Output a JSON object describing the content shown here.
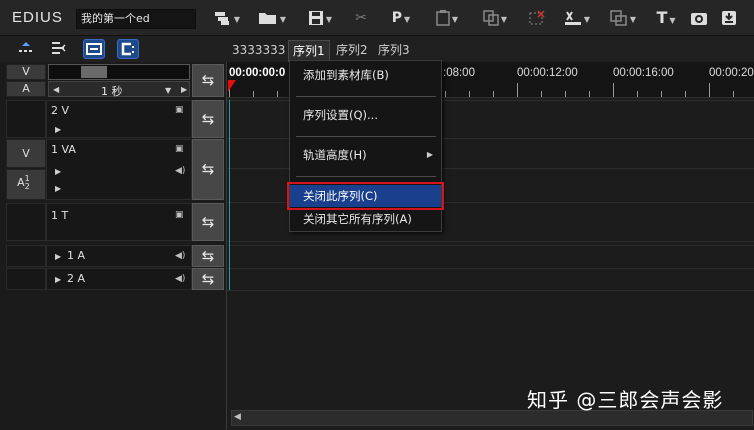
{
  "app": {
    "name": "EDIUS",
    "project_name": "我的第一个ed"
  },
  "toolbar": {
    "items": [
      "new-sequence-icon",
      "open-folder-icon",
      "save-icon",
      "cut-icon",
      "p-icon",
      "clipboard-icon",
      "copy-icon",
      "delete-icon",
      "in-out-icon",
      "ripple-icon",
      "text-icon",
      "capture-icon",
      "export-icon"
    ],
    "p_label": "P",
    "t_label": "T"
  },
  "tabs": [
    {
      "label": "3333333",
      "active": false
    },
    {
      "label": "序列1",
      "active": true
    },
    {
      "label": "序列2",
      "active": false
    },
    {
      "label": "序列3",
      "active": false
    }
  ],
  "header": {
    "v_label": "V",
    "a_label": "A",
    "scale_label": "1 秒"
  },
  "tracks": [
    {
      "name": "2 V"
    },
    {
      "name": "1 VA",
      "v_label": "V",
      "a_label": "A",
      "a_sup": "1",
      "a_sub": "2"
    },
    {
      "name": "1 T"
    },
    {
      "name": "1 A"
    },
    {
      "name": "2 A"
    }
  ],
  "timeline": {
    "timecodes": [
      "00:00:00:0",
      ":08:00",
      "00:00:12:00",
      "00:00:16:00",
      "00:00:20"
    ]
  },
  "menu": {
    "items": [
      {
        "label": "添加到素材库(B)"
      },
      {
        "label": "序列设置(Q)..."
      },
      {
        "label": "轨道高度(H)"
      },
      {
        "label": "关闭此序列(C)"
      },
      {
        "label": "关闭其它所有序列(A)"
      }
    ]
  },
  "colors": {
    "menu_highlight": "#1a3f8c",
    "highlight_border": "#d4141c",
    "active_button": "#1e4a8c"
  },
  "watermark": "知乎 @三郎会声会影"
}
